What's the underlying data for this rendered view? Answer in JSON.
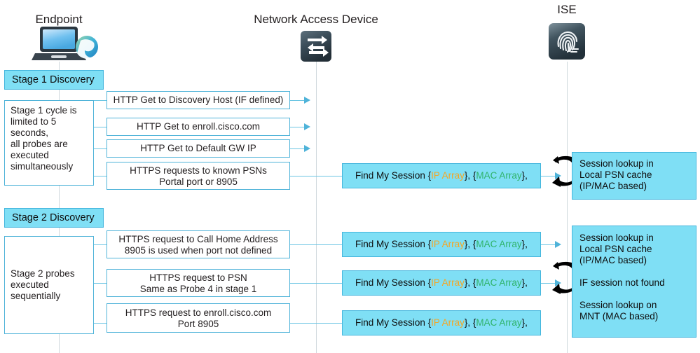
{
  "columns": [
    {
      "title": "Endpoint",
      "icon": "laptop-globe-icon"
    },
    {
      "title": "Network Access Device",
      "icon": "network-switch-icon"
    },
    {
      "title": "ISE",
      "icon": "fingerprint-icon"
    }
  ],
  "stages": [
    {
      "label": "Stage 1 Discovery",
      "note": "Stage 1 cycle is\nlimited to 5\nseconds,\nall probes are\nexecuted\nsimultaneously",
      "note_lines": [
        "Stage 1 cycle is",
        "limited to 5",
        "seconds,",
        "all probes are",
        "executed",
        "simultaneously"
      ],
      "probes": [
        {
          "lines": [
            "HTTP Get to Discovery Host (IF defined)"
          ],
          "has_arrow": true,
          "has_session": false
        },
        {
          "lines": [
            "HTTP Get to enroll.cisco.com"
          ],
          "has_arrow": true,
          "has_session": false
        },
        {
          "lines": [
            "HTTP Get to Default GW IP"
          ],
          "has_arrow": true,
          "has_session": false
        },
        {
          "lines": [
            "HTTPS requests to known PSNs",
            "Portal port or 8905"
          ],
          "has_arrow": false,
          "has_session": true
        }
      ],
      "ise_box_lines": [
        "Session lookup in",
        "Local PSN cache",
        "(IP/MAC based)"
      ]
    },
    {
      "label": "Stage 2 Discovery",
      "note_lines": [
        "Stage 2 probes",
        "executed",
        "sequentially"
      ],
      "probes": [
        {
          "lines": [
            "HTTPS request to Call Home Address",
            "8905 is used when port not defined"
          ],
          "has_arrow": false,
          "has_session": true
        },
        {
          "lines": [
            "HTTPS request to PSN",
            "Same as Probe 4 in stage 1"
          ],
          "has_arrow": false,
          "has_session": true
        },
        {
          "lines": [
            "HTTPS request to enroll.cisco.com",
            "Port 8905"
          ],
          "has_arrow": false,
          "has_session": true
        }
      ],
      "ise_box_lines": [
        "Session lookup in",
        "Local PSN cache",
        "(IP/MAC based)",
        "",
        "IF session not found",
        "",
        "Session lookup on",
        "MNT (MAC based)"
      ]
    }
  ],
  "session_message": {
    "prefix": "Find My Session {",
    "ip_array": "IP Array",
    "middle": "}, {",
    "mac_array": "MAC Array",
    "suffix": "},"
  },
  "colors": {
    "cyan_fill": "#7fdff5",
    "cyan_border": "#45b6dd",
    "line_blue": "#6cc5e3",
    "ip_array": "#f5a623",
    "mac_array": "#2fb36a",
    "text": "#231f20",
    "lifeline": "#cfd8dc",
    "icon_dark": "#2e4451"
  }
}
